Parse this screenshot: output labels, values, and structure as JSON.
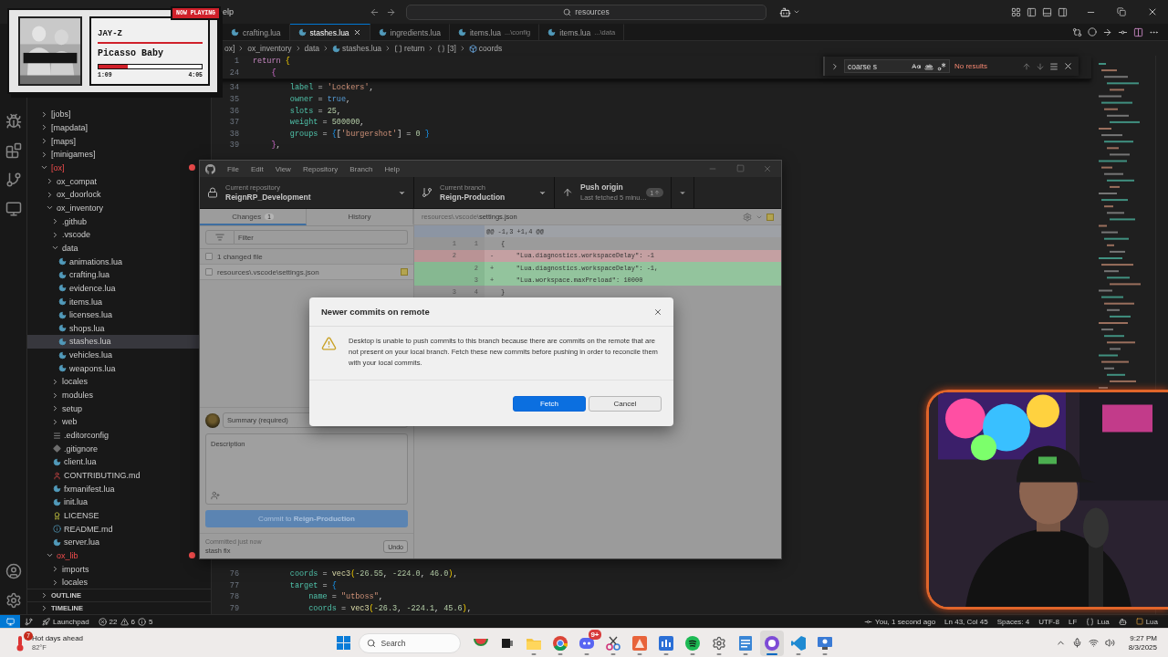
{
  "vscode": {
    "menu_fragment": "elp",
    "command_center": "resources",
    "explorer": {
      "tree": [
        {
          "label": "[jobs]",
          "kind": "folder",
          "expanded": false,
          "selected": false
        },
        {
          "label": "[mapdata]",
          "kind": "folder",
          "expanded": false,
          "selected": false
        },
        {
          "label": "[maps]",
          "kind": "folder",
          "expanded": false,
          "selected": false
        },
        {
          "label": "[minigames]",
          "kind": "folder",
          "expanded": false,
          "selected": false
        },
        {
          "label": "[ox]",
          "kind": "folder",
          "expanded": true,
          "selected": false,
          "color": "#f14c4c",
          "children": [
            {
              "label": "ox_compat",
              "kind": "folder",
              "expanded": false,
              "selected": false
            },
            {
              "label": "ox_doorlock",
              "kind": "folder",
              "expanded": false,
              "selected": false
            },
            {
              "label": "ox_inventory",
              "kind": "folder",
              "expanded": true,
              "selected": false,
              "children": [
                {
                  "label": ".github",
                  "kind": "folder",
                  "expanded": false,
                  "selected": false
                },
                {
                  "label": ".vscode",
                  "kind": "folder",
                  "expanded": false,
                  "selected": false
                },
                {
                  "label": "data",
                  "kind": "folder",
                  "expanded": true,
                  "selected": false,
                  "children": [
                    {
                      "label": "animations.lua",
                      "kind": "lua",
                      "selected": false
                    },
                    {
                      "label": "crafting.lua",
                      "kind": "lua",
                      "selected": false
                    },
                    {
                      "label": "evidence.lua",
                      "kind": "lua",
                      "selected": false
                    },
                    {
                      "label": "items.lua",
                      "kind": "lua",
                      "selected": false
                    },
                    {
                      "label": "licenses.lua",
                      "kind": "lua",
                      "selected": false
                    },
                    {
                      "label": "shops.lua",
                      "kind": "lua",
                      "selected": false
                    },
                    {
                      "label": "stashes.lua",
                      "kind": "lua",
                      "selected": true
                    },
                    {
                      "label": "vehicles.lua",
                      "kind": "lua",
                      "selected": false
                    },
                    {
                      "label": "weapons.lua",
                      "kind": "lua",
                      "selected": false
                    }
                  ]
                },
                {
                  "label": "locales",
                  "kind": "folder",
                  "expanded": false,
                  "selected": false
                },
                {
                  "label": "modules",
                  "kind": "folder",
                  "expanded": false,
                  "selected": false
                },
                {
                  "label": "setup",
                  "kind": "folder",
                  "expanded": false,
                  "selected": false
                },
                {
                  "label": "web",
                  "kind": "folder",
                  "expanded": false,
                  "selected": false
                },
                {
                  "label": ".editorconfig",
                  "kind": "config",
                  "selected": false
                },
                {
                  "label": ".gitignore",
                  "kind": "git",
                  "selected": false
                },
                {
                  "label": "client.lua",
                  "kind": "lua",
                  "selected": false
                },
                {
                  "label": "CONTRIBUTING.md",
                  "kind": "contrib",
                  "selected": false
                },
                {
                  "label": "fxmanifest.lua",
                  "kind": "lua",
                  "selected": false
                },
                {
                  "label": "init.lua",
                  "kind": "lua",
                  "selected": false
                },
                {
                  "label": "LICENSE",
                  "kind": "license",
                  "selected": false
                },
                {
                  "label": "README.md",
                  "kind": "readme",
                  "selected": false
                },
                {
                  "label": "server.lua",
                  "kind": "lua",
                  "selected": false
                }
              ]
            },
            {
              "label": "ox_lib",
              "kind": "folder",
              "expanded": true,
              "selected": false,
              "color": "#f14c4c",
              "children": [
                {
                  "label": "imports",
                  "kind": "folder",
                  "expanded": false,
                  "selected": false
                },
                {
                  "label": "locales",
                  "kind": "folder",
                  "expanded": false,
                  "selected": false
                }
              ]
            }
          ]
        }
      ],
      "sections": [
        {
          "label": "OUTLINE",
          "expanded": false
        },
        {
          "label": "TIMELINE",
          "expanded": false
        }
      ]
    },
    "tabs": [
      {
        "label": "crafting.lua",
        "selected": false
      },
      {
        "label": "stashes.lua",
        "selected": true
      },
      {
        "label": "ingredients.lua",
        "selected": false
      },
      {
        "label": "items.lua",
        "description": "...\\config",
        "selected": false
      },
      {
        "label": "items.lua",
        "description": "...\\data",
        "selected": false
      }
    ],
    "breadcrumb": [
      {
        "label": "ox]",
        "kind": "folder"
      },
      {
        "label": "ox_inventory",
        "kind": "folder"
      },
      {
        "label": "data",
        "kind": "folder"
      },
      {
        "label": "stashes.lua",
        "kind": "file"
      },
      {
        "label": "return",
        "kind": "array"
      },
      {
        "label": "[3]",
        "kind": "object"
      },
      {
        "label": "coords",
        "kind": "field"
      }
    ],
    "sticky_lines": [
      {
        "number": "1",
        "tokens": [
          {
            "kind": "keyword",
            "text": "return "
          },
          {
            "kind": "bracket1",
            "text": "{"
          }
        ]
      },
      {
        "number": "24",
        "tokens": [
          {
            "kind": "bracket2",
            "text": "    {"
          }
        ]
      }
    ],
    "lines_top": [
      {
        "number": "34",
        "tokens": [
          {
            "kind": "key",
            "text": "        label"
          },
          {
            "kind": "plain",
            "text": " = "
          },
          {
            "kind": "string",
            "text": "'Lockers'"
          },
          {
            "kind": "plain",
            "text": ","
          }
        ]
      },
      {
        "number": "35",
        "tokens": [
          {
            "kind": "key",
            "text": "        owner"
          },
          {
            "kind": "plain",
            "text": " = "
          },
          {
            "kind": "bool",
            "text": "true"
          },
          {
            "kind": "plain",
            "text": ","
          }
        ]
      },
      {
        "number": "36",
        "tokens": [
          {
            "kind": "key",
            "text": "        slots"
          },
          {
            "kind": "plain",
            "text": " = "
          },
          {
            "kind": "number",
            "text": "25"
          },
          {
            "kind": "plain",
            "text": ","
          }
        ]
      },
      {
        "number": "37",
        "tokens": [
          {
            "kind": "key",
            "text": "        weight"
          },
          {
            "kind": "plain",
            "text": " = "
          },
          {
            "kind": "number",
            "text": "500000"
          },
          {
            "kind": "plain",
            "text": ","
          }
        ]
      },
      {
        "number": "38",
        "tokens": [
          {
            "kind": "key",
            "text": "        groups"
          },
          {
            "kind": "plain",
            "text": " = "
          },
          {
            "kind": "bracket3",
            "text": "{"
          },
          {
            "kind": "plain",
            "text": "["
          },
          {
            "kind": "string",
            "text": "'burgershot'"
          },
          {
            "kind": "plain",
            "text": "] = "
          },
          {
            "kind": "number",
            "text": "0"
          },
          {
            "kind": "bracket3",
            "text": " }"
          }
        ]
      },
      {
        "number": "39",
        "tokens": [
          {
            "kind": "bracket2",
            "text": "    }"
          },
          {
            "kind": "plain",
            "text": ","
          }
        ]
      }
    ],
    "lines_bottom": [
      {
        "number": "76",
        "tokens": [
          {
            "kind": "key",
            "text": "        coords"
          },
          {
            "kind": "plain",
            "text": " = "
          },
          {
            "kind": "fn",
            "text": "vec3"
          },
          {
            "kind": "bracket1",
            "text": "("
          },
          {
            "kind": "number",
            "text": "-26.55"
          },
          {
            "kind": "plain",
            "text": ", "
          },
          {
            "kind": "number",
            "text": "-224.0"
          },
          {
            "kind": "plain",
            "text": ", "
          },
          {
            "kind": "number",
            "text": "46.0"
          },
          {
            "kind": "bracket1",
            "text": ")"
          },
          {
            "kind": "plain",
            "text": ","
          }
        ]
      },
      {
        "number": "77",
        "tokens": [
          {
            "kind": "key",
            "text": "        target"
          },
          {
            "kind": "plain",
            "text": " = "
          },
          {
            "kind": "bracket3",
            "text": "{"
          }
        ]
      },
      {
        "number": "78",
        "tokens": [
          {
            "kind": "key",
            "text": "            name"
          },
          {
            "kind": "plain",
            "text": " = "
          },
          {
            "kind": "string",
            "text": "\"utboss\""
          },
          {
            "kind": "plain",
            "text": ","
          }
        ]
      },
      {
        "number": "79",
        "tokens": [
          {
            "kind": "key",
            "text": "            coords"
          },
          {
            "kind": "plain",
            "text": " = "
          },
          {
            "kind": "fn",
            "text": "vec3"
          },
          {
            "kind": "bracket1",
            "text": "("
          },
          {
            "kind": "number",
            "text": "-26.3"
          },
          {
            "kind": "plain",
            "text": ", "
          },
          {
            "kind": "number",
            "text": "-224.1"
          },
          {
            "kind": "plain",
            "text": ", "
          },
          {
            "kind": "number",
            "text": "45.6"
          },
          {
            "kind": "bracket1",
            "text": ")"
          },
          {
            "kind": "plain",
            "text": ","
          }
        ]
      }
    ],
    "find": {
      "value": "coarse s",
      "result": "No results"
    },
    "status_left": {
      "launchpad": "Launchpad",
      "errors": "22",
      "warnings": "6",
      "infos": "5"
    },
    "status_right": [
      {
        "label": "You, 1 second ago",
        "kind": "blame"
      },
      {
        "label": "Ln 43, Col 45",
        "kind": "text"
      },
      {
        "label": "Spaces: 4",
        "kind": "text"
      },
      {
        "label": "UTF-8",
        "kind": "text"
      },
      {
        "label": "LF",
        "kind": "text"
      },
      {
        "label": "Lua",
        "kind": "language"
      },
      {
        "label": "Lua",
        "kind": "extension"
      }
    ]
  },
  "github_desktop": {
    "menu": [
      "File",
      "Edit",
      "View",
      "Repository",
      "Branch",
      "Help"
    ],
    "toolbar": [
      {
        "kind": "repository",
        "caption": "Current repository",
        "value": "ReignRP_Development"
      },
      {
        "kind": "branch",
        "caption": "Current branch",
        "value": "Reign-Production"
      },
      {
        "kind": "push",
        "caption": "Push origin",
        "value": "Last fetched 5 minu…",
        "badge": "1"
      }
    ],
    "tabs": [
      {
        "label": "Changes",
        "count": "1",
        "selected": true
      },
      {
        "label": "History",
        "selected": false
      }
    ],
    "filter_placeholder": "Filter",
    "changed_header": {
      "label": "1 changed file",
      "checked": false
    },
    "files": [
      {
        "path": "resources\\.vscode\\settings.json",
        "checked": false
      }
    ],
    "summary_placeholder": "Summary (required)",
    "description_placeholder": "Description",
    "commit_button": {
      "label": "Commit to **Reign-Production**",
      "disabled": true
    },
    "last_commit": {
      "caption": "Committed just now",
      "message": "stash fix",
      "undo": "Undo"
    },
    "diff": {
      "path": "resources\\.vscode\\**settings.json**",
      "hunk": "@@ -1,3 +1,4 @@",
      "lines": [
        {
          "kind": "context",
          "old": "1",
          "new": "1",
          "text": "{"
        },
        {
          "kind": "deleted",
          "old": "2",
          "marker": "-",
          "text": "    \"Lua.diagnostics.workspaceDelay\": -1"
        },
        {
          "kind": "added",
          "new": "2",
          "marker": "+",
          "text": "    \"Lua.diagnostics.workspaceDelay\": -1,"
        },
        {
          "kind": "added",
          "new": "3",
          "marker": "+",
          "text": "    \"Lua.workspace.maxPreload\": 10000"
        },
        {
          "kind": "context",
          "old": "3",
          "new": "4",
          "text": "}"
        }
      ]
    }
  },
  "dialog": {
    "title": "Newer commits on remote",
    "message": "Desktop is unable to push commits to this branch because there are commits on the remote that are not present on your local branch. Fetch these new commits before pushing in order to reconcile them with your local commits.",
    "buttons": [
      {
        "label": "Fetch",
        "kind": "primary"
      },
      {
        "label": "Cancel",
        "kind": "secondary"
      }
    ]
  },
  "now_playing": {
    "badge": "NOW PLAYING",
    "artist": "JAY-Z",
    "track": "Picasso Baby",
    "elapsed": "1:09",
    "duration": "4:05",
    "level": 0.28
  },
  "taskbar": {
    "weather": {
      "badge": "7",
      "headline": "Hot days ahead",
      "temperature": "82°F"
    },
    "search_placeholder": "Search",
    "apps": [
      {
        "kind": "watermelon",
        "running": false,
        "selected": false
      },
      {
        "kind": "taskview",
        "running": false,
        "selected": false
      },
      {
        "kind": "explorer",
        "running": true,
        "selected": false
      },
      {
        "kind": "chrome",
        "running": true,
        "selected": false
      },
      {
        "kind": "discord",
        "running": true,
        "selected": false,
        "badge": "9+"
      },
      {
        "kind": "snip",
        "running": true,
        "selected": false
      },
      {
        "kind": "adobe",
        "running": true,
        "selected": false
      },
      {
        "kind": "mold",
        "running": true,
        "selected": false
      },
      {
        "kind": "spotify",
        "running": true,
        "selected": false
      },
      {
        "kind": "settings",
        "running": true,
        "selected": false
      },
      {
        "kind": "notepad",
        "running": true,
        "selected": false
      },
      {
        "kind": "github",
        "running": true,
        "selected": true
      },
      {
        "kind": "vscode",
        "running": true,
        "selected": false
      },
      {
        "kind": "remote",
        "running": true,
        "selected": false
      }
    ],
    "time": "9:27 PM",
    "date": "8/3/2025"
  }
}
